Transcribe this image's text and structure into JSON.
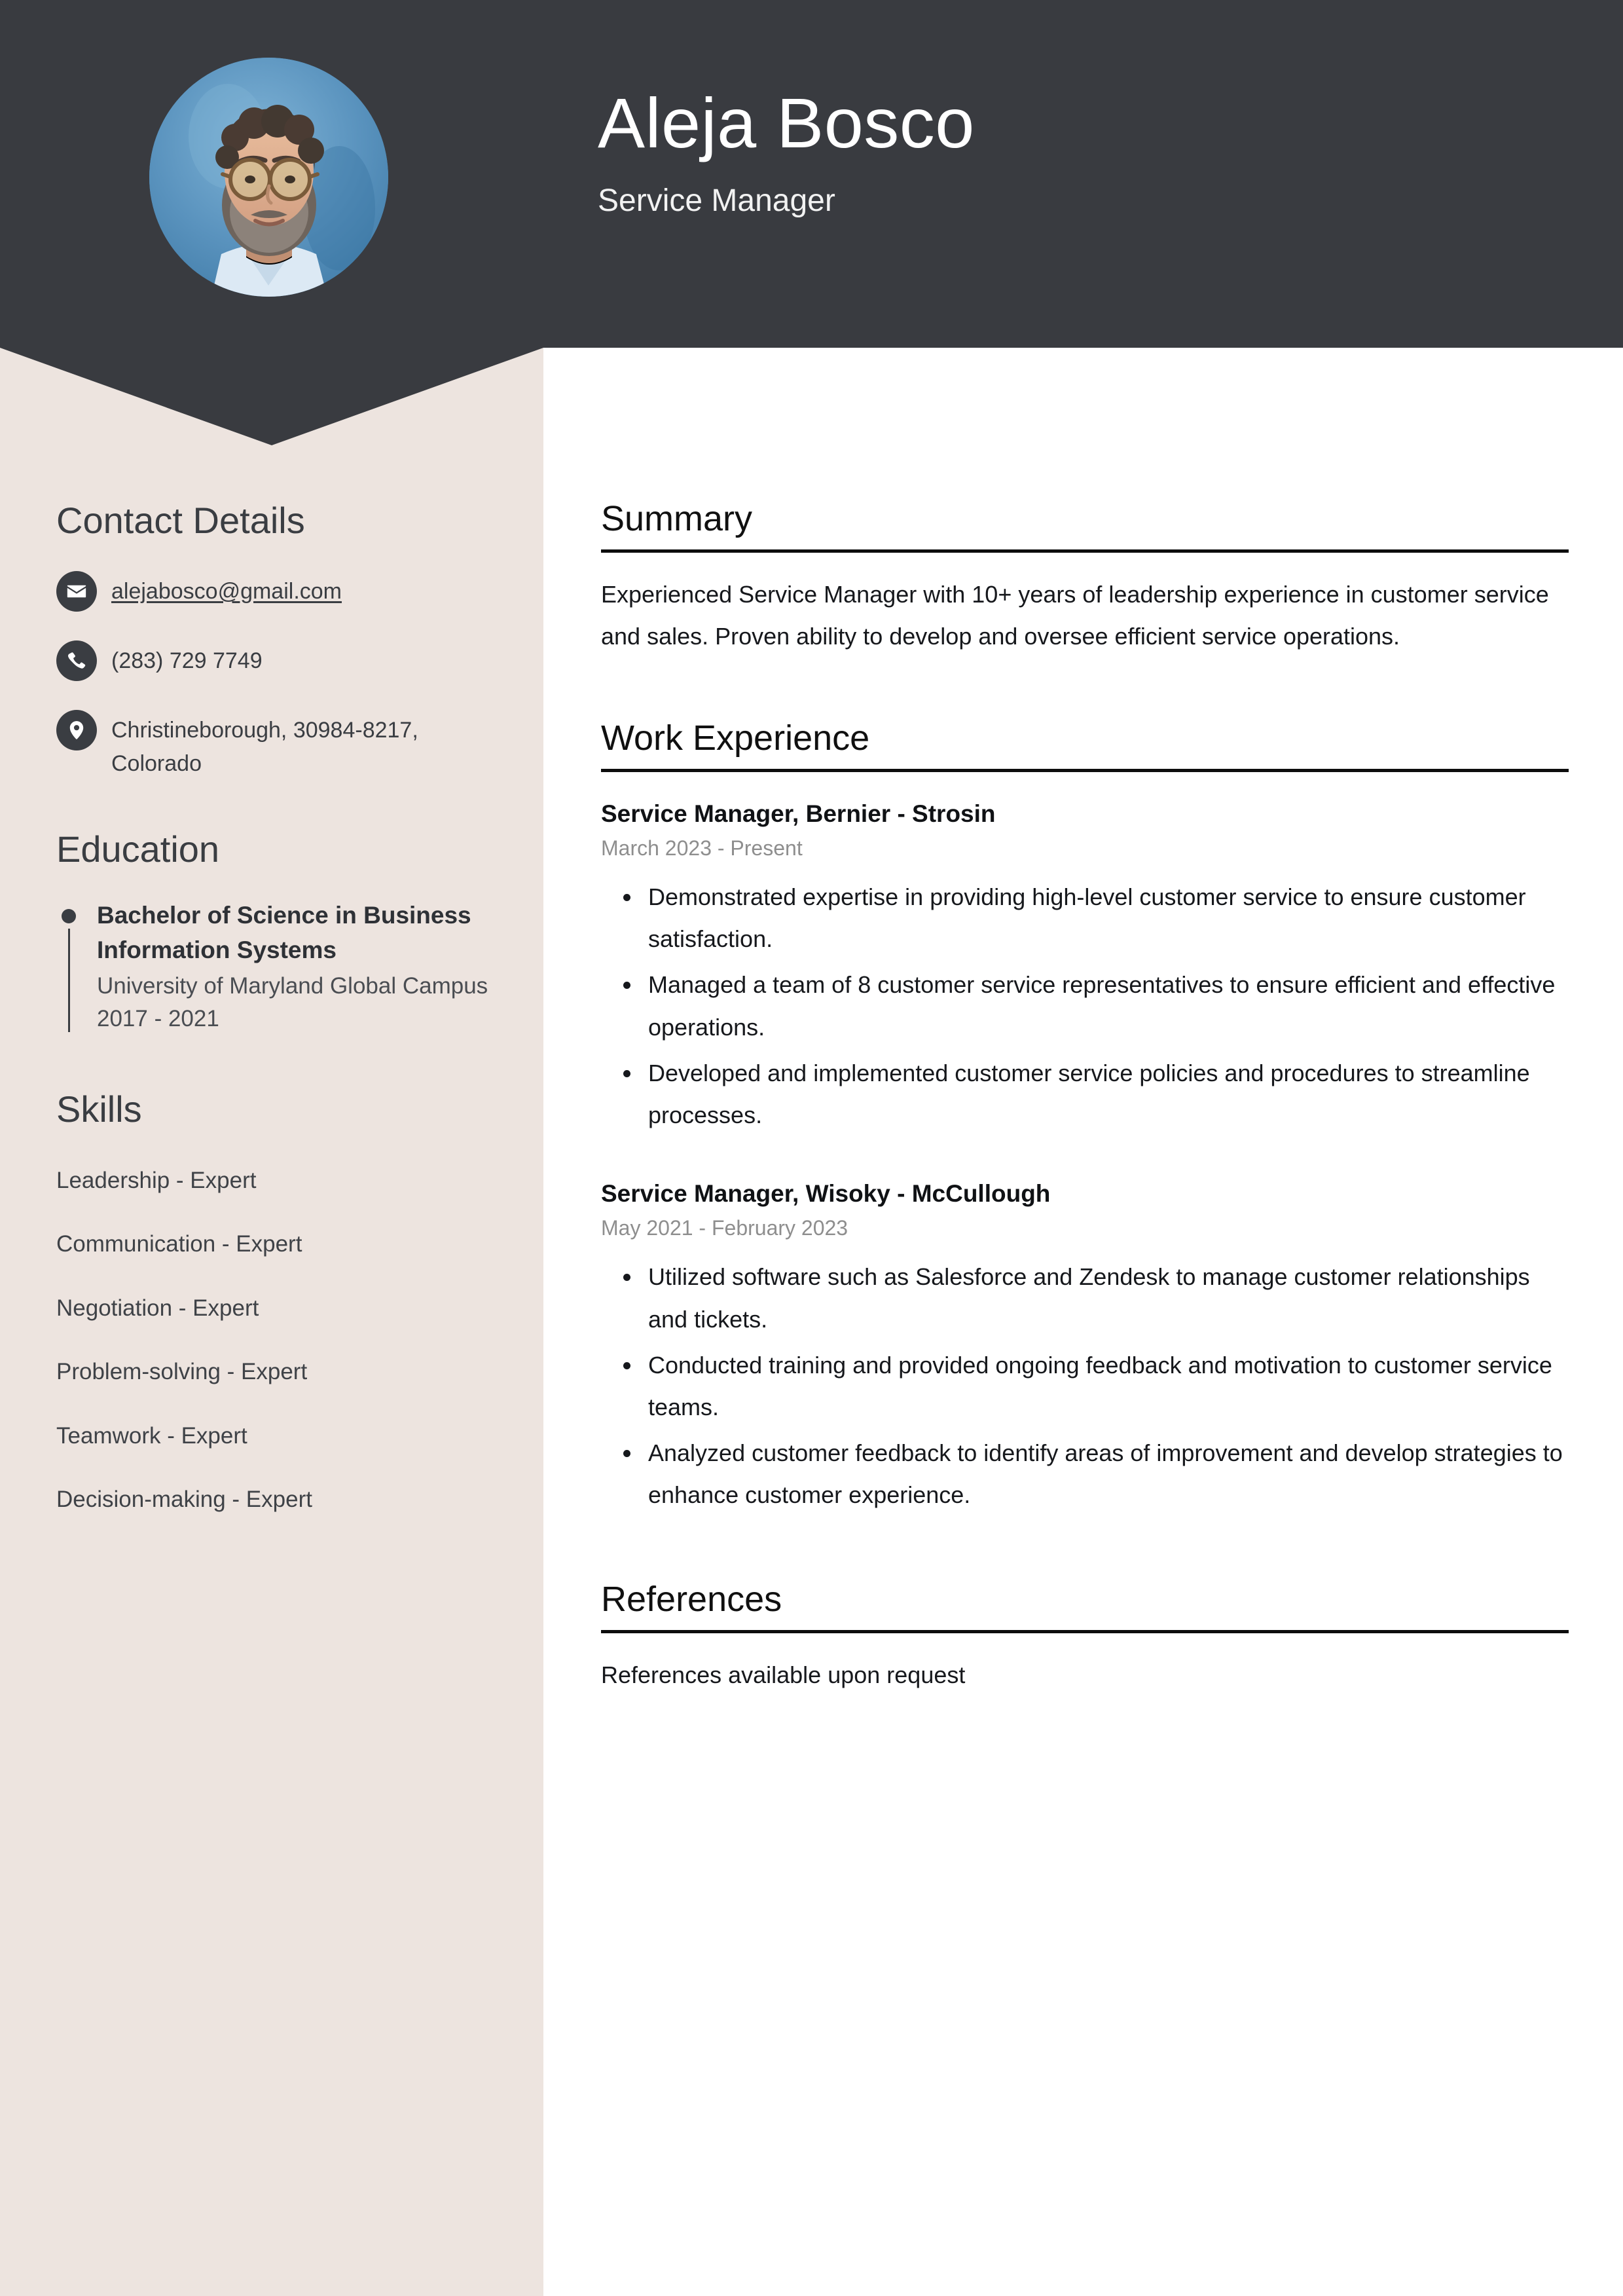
{
  "header": {
    "name": "Aleja Bosco",
    "job_title": "Service Manager",
    "avatar_alt": "profile-photo",
    "background_color": "#393B40"
  },
  "sidebar": {
    "background_color": "#EDE4DF",
    "contact": {
      "heading": "Contact Details",
      "items": [
        {
          "icon": "envelope-icon",
          "value": "alejabosco@gmail.com",
          "is_link": true
        },
        {
          "icon": "phone-icon",
          "value": "(283) 729 7749",
          "is_link": false
        },
        {
          "icon": "map-pin-icon",
          "value": "Christineborough, 30984-8217, Colorado",
          "is_link": false
        }
      ]
    },
    "education": {
      "heading": "Education",
      "items": [
        {
          "degree": "Bachelor of Science in Business Information Systems",
          "school": "University of Maryland Global Campus",
          "dates": "2017 - 2021"
        }
      ]
    },
    "skills": {
      "heading": "Skills",
      "items": [
        "Leadership - Expert",
        "Communication - Expert",
        "Negotiation - Expert",
        "Problem-solving - Expert",
        "Teamwork - Expert",
        "Decision-making - Expert"
      ]
    }
  },
  "main": {
    "summary": {
      "heading": "Summary",
      "text": "Experienced Service Manager with 10+ years of leadership experience in customer service and sales. Proven ability to develop and oversee efficient service operations."
    },
    "work": {
      "heading": "Work Experience",
      "jobs": [
        {
          "title": "Service Manager, Bernier - Strosin",
          "dates": "March 2023 - Present",
          "bullets": [
            "Demonstrated expertise in providing high-level customer service to ensure customer satisfaction.",
            "Managed a team of 8 customer service representatives to ensure efficient and effective operations.",
            "Developed and implemented customer service policies and procedures to streamline processes."
          ]
        },
        {
          "title": "Service Manager, Wisoky - McCullough",
          "dates": "May 2021 - February 2023",
          "bullets": [
            "Utilized software such as Salesforce and Zendesk to manage customer relationships and tickets.",
            "Conducted training and provided ongoing feedback and motivation to customer service teams.",
            "Analyzed customer feedback to identify areas of improvement and develop strategies to enhance customer experience."
          ]
        }
      ]
    },
    "references": {
      "heading": "References",
      "text": "References available upon request"
    }
  }
}
